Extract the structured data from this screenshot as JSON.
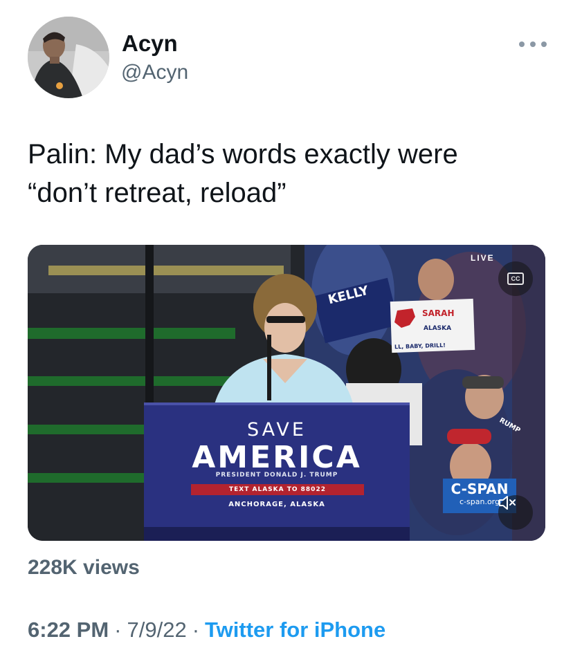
{
  "author": {
    "name": "Acyn",
    "handle": "@Acyn",
    "avatar_icon": "avatar-photo"
  },
  "tweet": {
    "text_line_1": "Palin: My dad’s words exactly were",
    "text_line_2": "“don’t retreat, reload”"
  },
  "video": {
    "live_label": "LIVE",
    "cc_label": "CC",
    "podium": {
      "line_1": "SAVE",
      "line_2": "AMERICA",
      "line_3": "PRESIDENT DONALD J. TRUMP",
      "line_4": "TEXT ALASKA TO 88022",
      "line_5": "ANCHORAGE, ALASKA"
    },
    "signs": {
      "kelly": "KELLY",
      "sarah": "SARAH",
      "alaska": "ALASKA",
      "drill": "LL, BABY, DRILL!",
      "trump": "RUMP"
    },
    "network_logo": "C-SPAN",
    "network_url": "c-span.org",
    "mute_icon": "speaker-muted-icon"
  },
  "stats": {
    "views": "228K views"
  },
  "meta": {
    "time": "6:22 PM",
    "separator": "·",
    "date": "7/9/22",
    "source": "Twitter for iPhone"
  },
  "colors": {
    "text_primary": "#0f1419",
    "text_secondary": "#536471",
    "link": "#1d9bf0",
    "podium_blue": "#2a3180",
    "podium_red": "#b3232f",
    "cspan_blue": "#2160b8"
  }
}
